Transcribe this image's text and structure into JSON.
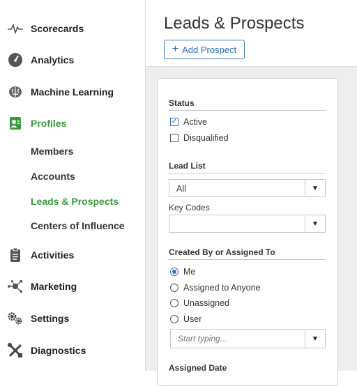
{
  "sidebar": {
    "items": [
      {
        "label": "Scorecards",
        "icon": "pulse-icon"
      },
      {
        "label": "Analytics",
        "icon": "gauge-icon"
      },
      {
        "label": "Machine Learning",
        "icon": "brain-icon"
      },
      {
        "label": "Profiles",
        "icon": "profile-card-icon"
      },
      {
        "label": "Activities",
        "icon": "clipboard-icon"
      },
      {
        "label": "Marketing",
        "icon": "network-icon"
      },
      {
        "label": "Settings",
        "icon": "gears-icon"
      },
      {
        "label": "Diagnostics",
        "icon": "tools-icon"
      }
    ],
    "sub_items": [
      {
        "label": "Members"
      },
      {
        "label": "Accounts"
      },
      {
        "label": "Leads & Prospects"
      },
      {
        "label": "Centers of Influence"
      }
    ]
  },
  "header": {
    "title": "Leads & Prospects",
    "add_button": "Add Prospect"
  },
  "filters": {
    "status": {
      "title": "Status",
      "options": [
        {
          "label": "Active",
          "checked": true
        },
        {
          "label": "Disqualified",
          "checked": false
        }
      ]
    },
    "lead_list": {
      "title": "Lead List",
      "value": "All"
    },
    "key_codes": {
      "title": "Key Codes",
      "value": ""
    },
    "created_by": {
      "title": "Created By or Assigned To",
      "options": [
        {
          "label": "Me",
          "selected": true
        },
        {
          "label": "Assigned to Anyone",
          "selected": false
        },
        {
          "label": "Unassigned",
          "selected": false
        },
        {
          "label": "User",
          "selected": false
        }
      ],
      "user_placeholder": "Start typing..."
    },
    "assigned_date": {
      "title": "Assigned Date"
    }
  },
  "colors": {
    "accent_green": "#3c9a3c",
    "accent_blue": "#2d6fb4",
    "content_bg": "#eeeeee"
  }
}
